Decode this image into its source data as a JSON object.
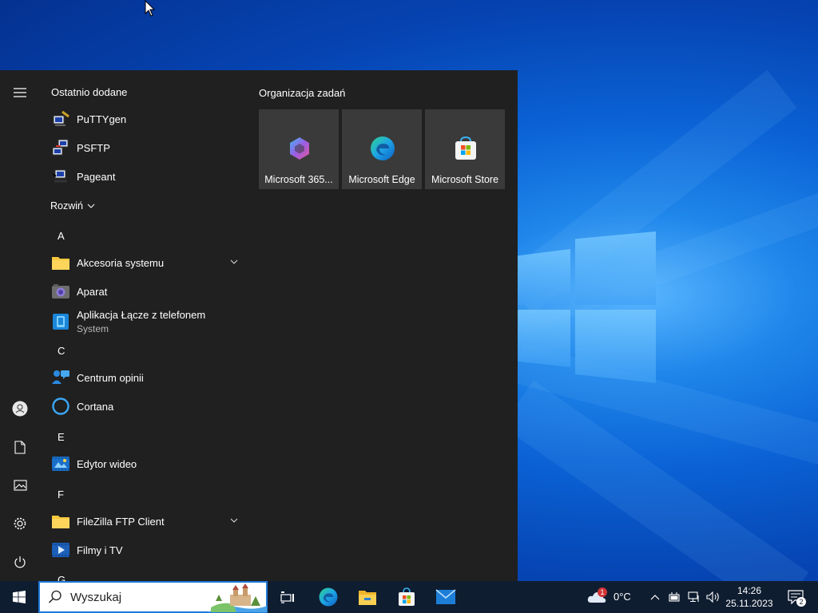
{
  "start_menu": {
    "recent_title": "Ostatnio dodane",
    "recent_apps": [
      {
        "label": "PuTTYgen"
      },
      {
        "label": "PSFTP"
      },
      {
        "label": "Pageant"
      }
    ],
    "expand_label": "Rozwiń",
    "letters": {
      "a": "A",
      "c": "C",
      "e": "E",
      "f": "F",
      "g": "G"
    },
    "apps": {
      "akcesoria": {
        "label": "Akcesoria systemu"
      },
      "aparat": {
        "label": "Aparat"
      },
      "aplikacja": {
        "label": "Aplikacja Łącze z telefonem",
        "sublabel": "System"
      },
      "centrum": {
        "label": "Centrum opinii"
      },
      "cortana": {
        "label": "Cortana"
      },
      "edytor": {
        "label": "Edytor wideo"
      },
      "filezilla": {
        "label": "FileZilla FTP Client"
      },
      "filmy": {
        "label": "Filmy i TV"
      }
    },
    "tiles_title": "Organizacja zadań",
    "tiles": [
      {
        "label": "Microsoft 365...",
        "icon": "m365-icon"
      },
      {
        "label": "Microsoft Edge",
        "icon": "edge-icon"
      },
      {
        "label": "Microsoft Store",
        "icon": "store-icon"
      }
    ]
  },
  "taskbar": {
    "search_placeholder": "Wyszukaj",
    "weather_temp": "0°C",
    "weather_badge": "1",
    "time": "14:26",
    "date": "25.11.2023",
    "notifications_count": "2"
  },
  "colors": {
    "start_bg": "#202020",
    "tile_bg": "#3a3a3a",
    "taskbar_bg": "#0f1d31",
    "accent": "#0078d4"
  }
}
